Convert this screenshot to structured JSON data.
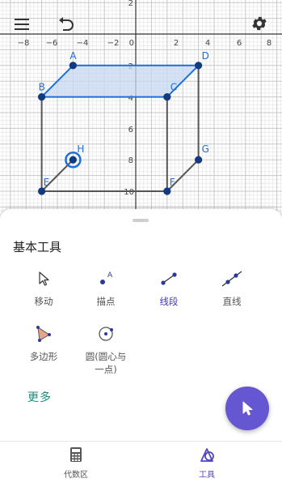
{
  "toolbar": {
    "menu_icon": "hamburger-icon",
    "undo_icon": "undo-icon",
    "settings_icon": "gear-icon"
  },
  "graph": {
    "x_ticks": [
      "−8",
      "−6",
      "−4",
      "−2",
      "0",
      "2",
      "4",
      "6",
      "8"
    ],
    "y_ticks": [
      "2",
      "2",
      "4",
      "6",
      "8",
      "10"
    ],
    "points": [
      {
        "label": "A",
        "x": -4,
        "y": -2
      },
      {
        "label": "B",
        "x": -6,
        "y": -4
      },
      {
        "label": "C",
        "x": 2,
        "y": -4
      },
      {
        "label": "D",
        "x": 4,
        "y": -2
      },
      {
        "label": "E",
        "x": -6,
        "y": -10
      },
      {
        "label": "F",
        "x": 2,
        "y": -10
      },
      {
        "label": "G",
        "x": 4,
        "y": -8
      },
      {
        "label": "H",
        "x": -4,
        "y": -8
      }
    ],
    "selected_point": "H",
    "colors": {
      "point": "#1565c0",
      "polygon_fill": "#c7d8f3",
      "segment": "#555555"
    }
  },
  "panel": {
    "section_title": "基本工具",
    "tools": [
      {
        "label": "移动",
        "icon": "cursor-icon"
      },
      {
        "label": "描点",
        "icon": "point-icon"
      },
      {
        "label": "线段",
        "icon": "segment-icon"
      },
      {
        "label": "直线",
        "icon": "line-icon"
      },
      {
        "label": "多边形",
        "icon": "polygon-icon"
      },
      {
        "label": "圆(圆心与一点)",
        "icon": "circle-icon"
      }
    ],
    "active_tool": "线段",
    "more_label": "更多",
    "fab_icon": "cursor-icon"
  },
  "nav": {
    "items": [
      {
        "label": "代数区",
        "icon": "calculator-icon"
      },
      {
        "label": "工具",
        "icon": "tools-icon"
      }
    ],
    "active": "工具"
  }
}
